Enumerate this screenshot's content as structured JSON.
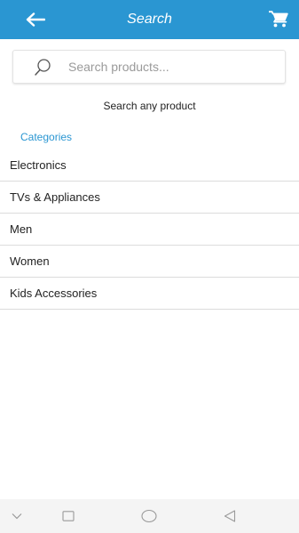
{
  "header": {
    "title": "Search",
    "back_icon": "arrow-left-icon",
    "cart_icon": "cart-icon",
    "background": "#2a96d2"
  },
  "search": {
    "placeholder": "Search products...",
    "value": "",
    "icon": "search-icon",
    "hint": "Search any product"
  },
  "categories": {
    "heading": "Categories",
    "items": [
      {
        "label": "Electronics"
      },
      {
        "label": "TVs & Appliances"
      },
      {
        "label": "Men"
      },
      {
        "label": "Women"
      },
      {
        "label": "Kids Accessories"
      }
    ]
  },
  "system_nav": {
    "buttons": [
      "chevron-down-icon",
      "recents-icon",
      "home-icon",
      "back-triangle-icon"
    ]
  }
}
